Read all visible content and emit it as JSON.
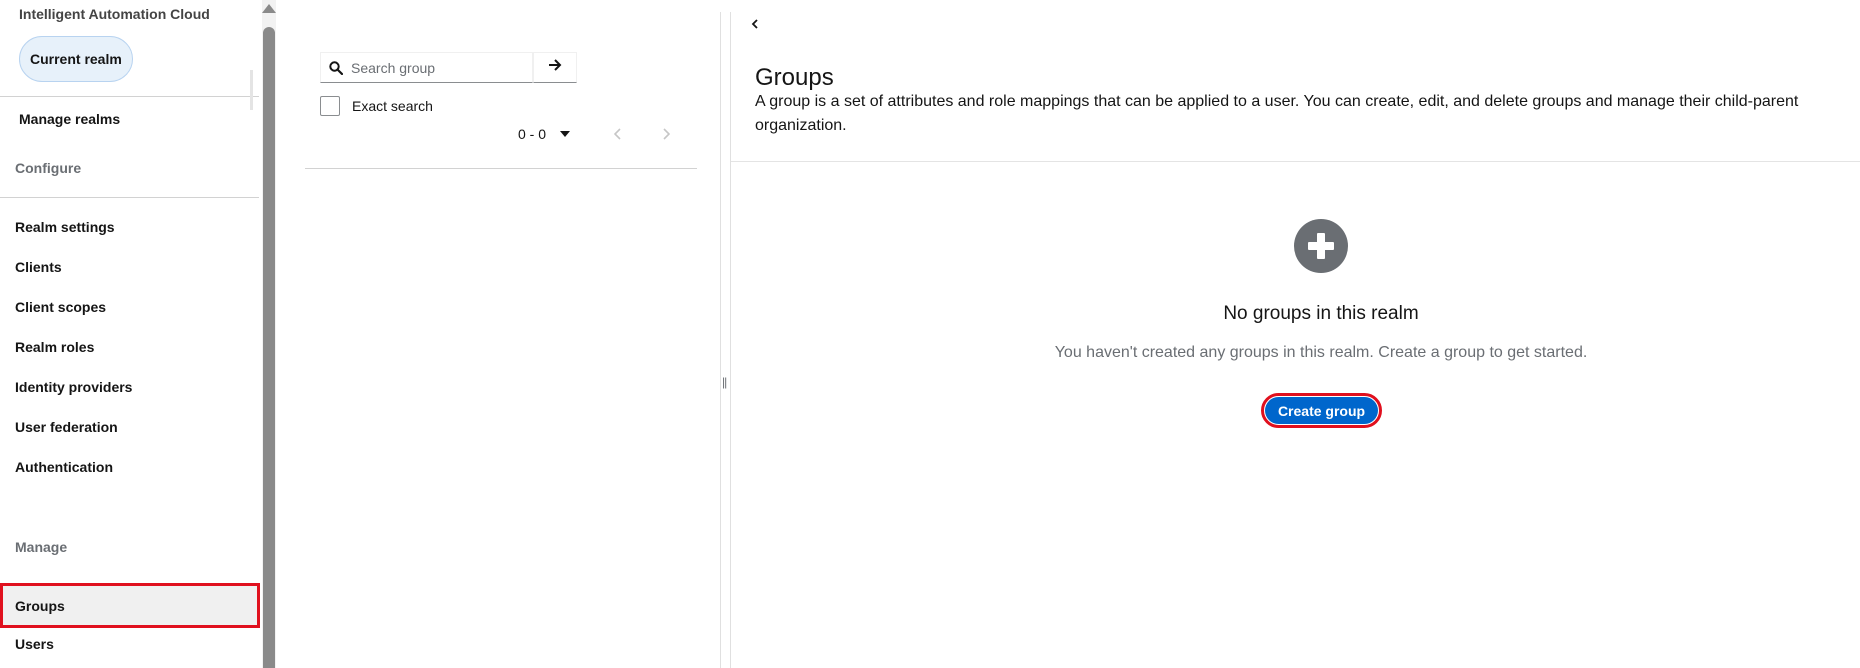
{
  "sidebar": {
    "realm_name": "Intelligent Automation Cloud",
    "current_realm_label": "Current realm",
    "manage_realms_label": "Manage realms",
    "configure_title": "Configure",
    "configure_items": [
      "Realm settings",
      "Clients",
      "Client scopes",
      "Realm roles",
      "Identity providers",
      "User federation",
      "Authentication"
    ],
    "manage_title": "Manage",
    "manage_items": [
      "Groups",
      "Users"
    ],
    "selected_item": "Groups"
  },
  "tree": {
    "search_placeholder": "Search group",
    "exact_search_label": "Exact search",
    "pagination_range": "0 - 0"
  },
  "main": {
    "title": "Groups",
    "description": "A group is a set of attributes and role mappings that can be applied to a user. You can create, edit, and delete groups and manage their child-parent organization.",
    "empty_title": "No groups in this realm",
    "empty_body": "You haven't created any groups in this realm. Create a group to get started.",
    "create_button_label": "Create group"
  },
  "colors": {
    "primary": "#0066cc",
    "highlight": "#e0101e",
    "pill_bg": "#e7f1fa"
  },
  "icons": {
    "search": "search-icon",
    "arrow_right": "arrow-right-icon",
    "plus_circle": "plus-circle-icon",
    "chevron_left": "chevron-left-icon",
    "chevron_right": "chevron-right-icon",
    "caret_down": "caret-down-icon"
  }
}
